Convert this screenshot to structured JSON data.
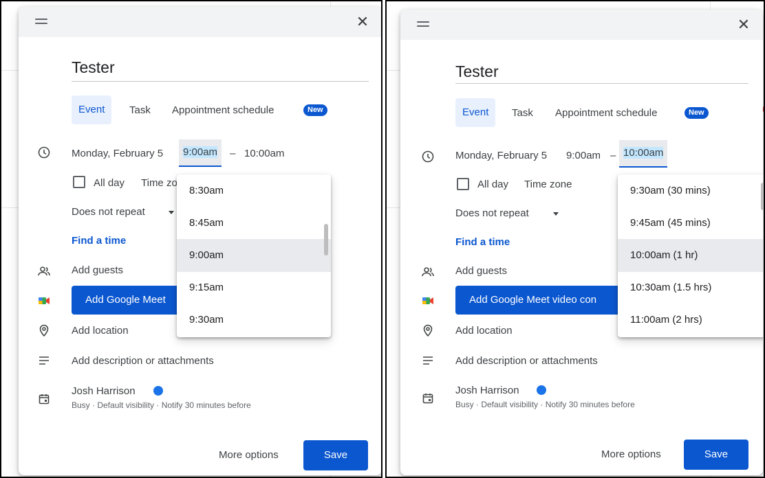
{
  "panels": [
    {
      "title": "Tester",
      "tabs": {
        "event": "Event",
        "task": "Task",
        "appointment": "Appointment schedule",
        "badge": "New"
      },
      "date": "Monday, February 5",
      "start_time": "9:00am",
      "separator": "–",
      "end_time": "10:00am",
      "all_day": "All day",
      "time_zone": "Time zo",
      "repeat": "Does not repeat",
      "find_time": "Find a time",
      "add_guests": "Add guests",
      "meet_button": "Add Google Meet",
      "add_location": "Add location",
      "add_description": "Add description or attachments",
      "owner": "Josh Harrison",
      "owner_details": "Busy · Default visibility · Notify 30 minutes before",
      "more_options": "More options",
      "save": "Save",
      "dropdown": {
        "selected": "9:00am",
        "options": [
          "8:30am",
          "8:45am",
          "9:00am",
          "9:15am",
          "9:30am"
        ]
      }
    },
    {
      "title": "Tester",
      "tabs": {
        "event": "Event",
        "task": "Task",
        "appointment": "Appointment schedule",
        "badge": "New"
      },
      "date": "Monday, February 5",
      "start_time": "9:00am",
      "separator": "–",
      "end_time": "10:00am",
      "all_day": "All day",
      "time_zone": "Time zone",
      "repeat": "Does not repeat",
      "find_time": "Find a time",
      "add_guests": "Add guests",
      "meet_button": "Add Google Meet video con",
      "add_location": "Add location",
      "add_description": "Add description or attachments",
      "owner": "Josh Harrison",
      "owner_details": "Busy · Default visibility · Notify 30 minutes before",
      "more_options": "More options",
      "save": "Save",
      "dropdown": {
        "selected": "10:00am (1 hr)",
        "options": [
          "9:30am (30 mins)",
          "9:45am (45 mins)",
          "10:00am (1 hr)",
          "10:30am (1.5 hrs)",
          "11:00am (2 hrs)"
        ]
      }
    }
  ],
  "colors": {
    "accent": "#0b57d0",
    "selected_bg": "#e8eaed",
    "owner_dot": "#1a73e8"
  }
}
